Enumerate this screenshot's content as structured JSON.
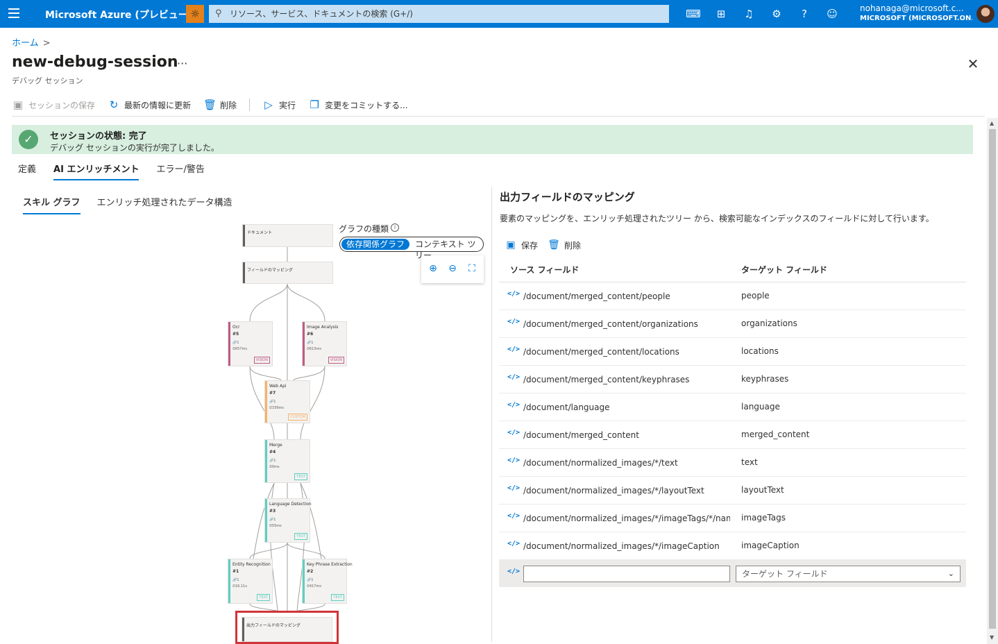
{
  "topbar": {
    "brand": "Microsoft Azure (プレビュー)",
    "search_placeholder": "リソース、サービス、ドキュメントの検索 (G+/)",
    "user_email": "nohanaga@microsoft.c...",
    "user_tenant": "MICROSOFT (MICROSOFT.ON...",
    "icons": [
      "menu-icon",
      "bug-icon",
      "cloud-shell-icon",
      "directory-filter-icon",
      "notification-icon",
      "settings-icon",
      "help-icon",
      "feedback-icon"
    ]
  },
  "breadcrumb": {
    "home": "ホーム",
    "separator": ">"
  },
  "page": {
    "title": "new-debug-session",
    "more": "···",
    "subtitle": "デバッグ セッション",
    "close": "✕"
  },
  "commands": {
    "save": "セッションの保存",
    "refresh": "最新の情報に更新",
    "delete": "削除",
    "run": "実行",
    "commit": "変更をコミットする..."
  },
  "status": {
    "title": "セッションの状態: 完了",
    "message": "デバッグ セッションの実行が完了しました。",
    "color": "#d8efe0"
  },
  "tabs": [
    {
      "label": "定義",
      "active": false
    },
    {
      "label": "AI エンリッチメント",
      "active": true
    },
    {
      "label": "エラー/警告",
      "active": false
    }
  ],
  "subtabs": [
    {
      "label": "スキル グラフ",
      "active": true
    },
    {
      "label": "エンリッチ処理されたデータ構造",
      "active": false
    }
  ],
  "graph": {
    "type_label": "グラフの種類",
    "type_options": [
      "依存関係グラフ",
      "コンテキスト ツリー"
    ],
    "selected_type": "依存関係グラフ",
    "zoom_icons": [
      "zoom-in-icon",
      "zoom-out-icon",
      "fit-view-icon"
    ],
    "nodes": [
      {
        "key": "document",
        "name": "ドキュメント"
      },
      {
        "key": "field-mappings",
        "name": "フィールドのマッピング"
      },
      {
        "key": "ocr",
        "name": "Ocr",
        "id": "#5",
        "count": "1",
        "time": "657ms",
        "tag": "VISION",
        "color": "#c05a86"
      },
      {
        "key": "image-analysis",
        "name": "Image Analysis",
        "id": "#6",
        "count": "1",
        "time": "613ms",
        "tag": "VISION",
        "color": "#c05a86"
      },
      {
        "key": "web-api",
        "name": "Web Api",
        "id": "#7",
        "count": "1",
        "time": "339ms",
        "tag": "CUSTOM",
        "color": "#f7b267"
      },
      {
        "key": "merge",
        "name": "Merge",
        "id": "#4",
        "count": "1",
        "time": "0ms",
        "tag": "TEXT",
        "color": "#5ecfc0"
      },
      {
        "key": "language-detection",
        "name": "Language Detection",
        "id": "#3",
        "count": "1",
        "time": "55ms",
        "tag": "TEXT",
        "color": "#5ecfc0"
      },
      {
        "key": "entity-recognition",
        "name": "Entity Recognition",
        "id": "#1",
        "count": "1",
        "time": "16.11s",
        "tag": "TEXT",
        "color": "#5ecfc0"
      },
      {
        "key": "key-phrase-extraction",
        "name": "Key Phrase Extraction",
        "id": "#2",
        "count": "1",
        "time": "417ms",
        "tag": "TEXT",
        "color": "#5ecfc0"
      },
      {
        "key": "output-field-mappings",
        "name": "出力フィールドのマッピング"
      }
    ]
  },
  "mapping": {
    "title": "出力フィールドのマッピング",
    "description": "要素のマッピングを、エンリッチ処理されたツリー から、検索可能なインデックスのフィールドに対して行います。",
    "save": "保存",
    "delete": "削除",
    "col_source": "ソース フィールド",
    "col_target": "ターゲット フィールド",
    "rows": [
      {
        "source": "/document/merged_content/people",
        "target": "people"
      },
      {
        "source": "/document/merged_content/organizations",
        "target": "organizations"
      },
      {
        "source": "/document/merged_content/locations",
        "target": "locations"
      },
      {
        "source": "/document/merged_content/keyphrases",
        "target": "keyphrases"
      },
      {
        "source": "/document/language",
        "target": "language"
      },
      {
        "source": "/document/merged_content",
        "target": "merged_content"
      },
      {
        "source": "/document/normalized_images/*/text",
        "target": "text"
      },
      {
        "source": "/document/normalized_images/*/layoutText",
        "target": "layoutText"
      },
      {
        "source": "/document/normalized_images/*/imageTags/*/name",
        "target": "imageTags"
      },
      {
        "source": "/document/normalized_images/*/imageCaption",
        "target": "imageCaption"
      }
    ],
    "new_source_value": "",
    "new_target_placeholder": "ターゲット フィールド"
  }
}
